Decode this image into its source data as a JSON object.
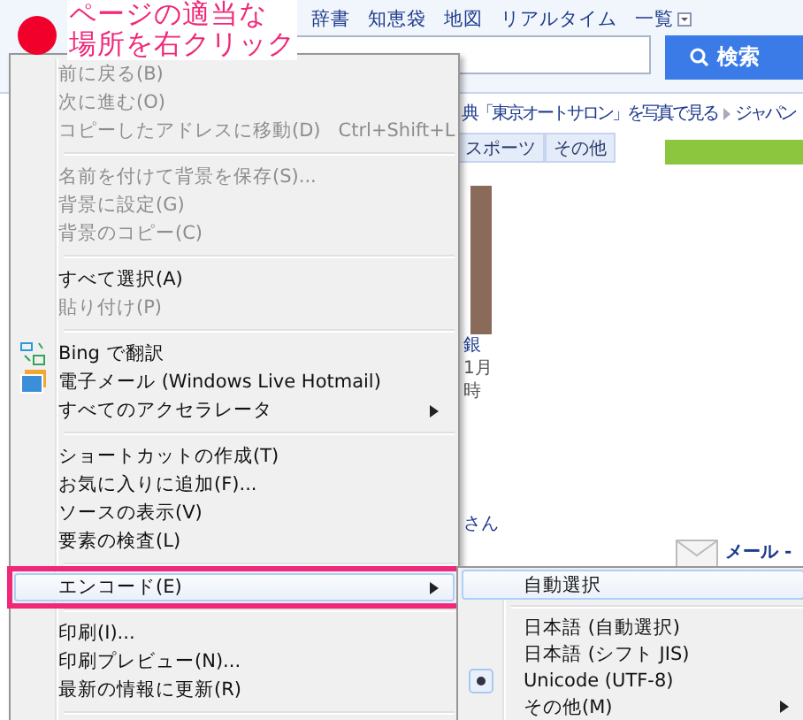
{
  "annotation": {
    "lines": [
      "ページの適当な",
      "場所を右クリック"
    ]
  },
  "page": {
    "nav_links": [
      "辞書",
      "知恵袋",
      "地図",
      "リアルタイム",
      "一覧"
    ],
    "search_button": "検索",
    "headline": "典「東京オートサロン」を写真で見る",
    "headline_2": "ジャパン",
    "tabs": [
      "スポーツ",
      "その他"
    ],
    "story_lines": [
      "銀",
      "1月",
      "時"
    ],
    "story_tail": "さん",
    "mail_label": "メール -"
  },
  "context_menu": {
    "items": [
      {
        "kind": "item",
        "label": "前に戻る(B)",
        "disabled": true
      },
      {
        "kind": "item",
        "label": "次に進む(O)",
        "disabled": true
      },
      {
        "kind": "item",
        "label": "コピーしたアドレスに移動(D)",
        "shortcut": "Ctrl+Shift+L",
        "disabled": true
      },
      {
        "kind": "separator"
      },
      {
        "kind": "item",
        "label": "名前を付けて背景を保存(S)...",
        "disabled": true
      },
      {
        "kind": "item",
        "label": "背景に設定(G)",
        "disabled": true
      },
      {
        "kind": "item",
        "label": "背景のコピー(C)",
        "disabled": true
      },
      {
        "kind": "separator"
      },
      {
        "kind": "item",
        "label": "すべて選択(A)",
        "disabled": false
      },
      {
        "kind": "item",
        "label": "貼り付け(P)",
        "disabled": true
      },
      {
        "kind": "separator"
      },
      {
        "kind": "item",
        "label": "Bing で翻訳",
        "disabled": false
      },
      {
        "kind": "item",
        "label": "電子メール (Windows Live Hotmail)",
        "disabled": false
      },
      {
        "kind": "item",
        "label": "すべてのアクセラレータ",
        "disabled": false,
        "submenu": true
      },
      {
        "kind": "separator"
      },
      {
        "kind": "item",
        "label": "ショートカットの作成(T)",
        "disabled": false
      },
      {
        "kind": "item",
        "label": "お気に入りに追加(F)...",
        "disabled": false
      },
      {
        "kind": "item",
        "label": "ソースの表示(V)",
        "disabled": false
      },
      {
        "kind": "item",
        "label": "要素の検査(L)",
        "disabled": false
      },
      {
        "kind": "separator"
      },
      {
        "kind": "item",
        "label": "エンコード(E)",
        "disabled": false,
        "submenu": true,
        "highlighted": true,
        "marked": true
      },
      {
        "kind": "separator"
      },
      {
        "kind": "item",
        "label": "印刷(I)...",
        "disabled": false
      },
      {
        "kind": "item",
        "label": "印刷プレビュー(N)...",
        "disabled": false
      },
      {
        "kind": "item",
        "label": "最新の情報に更新(R)",
        "disabled": false
      },
      {
        "kind": "separator"
      }
    ]
  },
  "encoding_submenu": {
    "items": [
      {
        "kind": "item",
        "label": "自動選択",
        "highlighted": true,
        "checked": false
      },
      {
        "kind": "separator"
      },
      {
        "kind": "item",
        "label": "日本語 (自動選択)",
        "highlighted": false,
        "checked": false
      },
      {
        "kind": "item",
        "label": "日本語 (シフト JIS)",
        "highlighted": false,
        "checked": false
      },
      {
        "kind": "item",
        "label": "Unicode (UTF-8)",
        "highlighted": false,
        "checked": true
      },
      {
        "kind": "item",
        "label": "その他(M)",
        "highlighted": false,
        "checked": false,
        "submenu": true
      }
    ]
  }
}
